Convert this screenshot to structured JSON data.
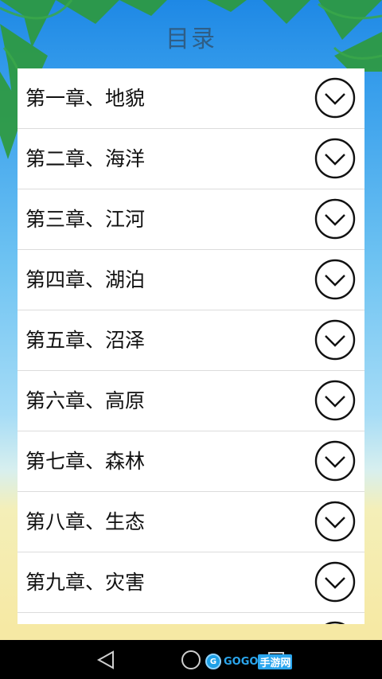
{
  "header": {
    "title": "目录"
  },
  "chapters": [
    {
      "label": "第一章、地貌"
    },
    {
      "label": "第二章、海洋"
    },
    {
      "label": "第三章、江河"
    },
    {
      "label": "第四章、湖泊"
    },
    {
      "label": "第五章、沼泽"
    },
    {
      "label": "第六章、高原"
    },
    {
      "label": "第七章、森林"
    },
    {
      "label": "第八章、生态"
    },
    {
      "label": "第九章、灾害"
    }
  ],
  "watermark": {
    "brand": "GOGO",
    "suffix": "手游网"
  },
  "colors": {
    "title": "#2f5e86",
    "sky_top": "#1e88e5",
    "sand": "#f6e9a4",
    "list_bg": "#ffffff",
    "navbar": "#000000"
  },
  "icons": {
    "expand": "chevron-down-circle-icon",
    "back": "back-triangle-icon",
    "home": "home-circle-icon",
    "recents": "recents-square-icon"
  }
}
